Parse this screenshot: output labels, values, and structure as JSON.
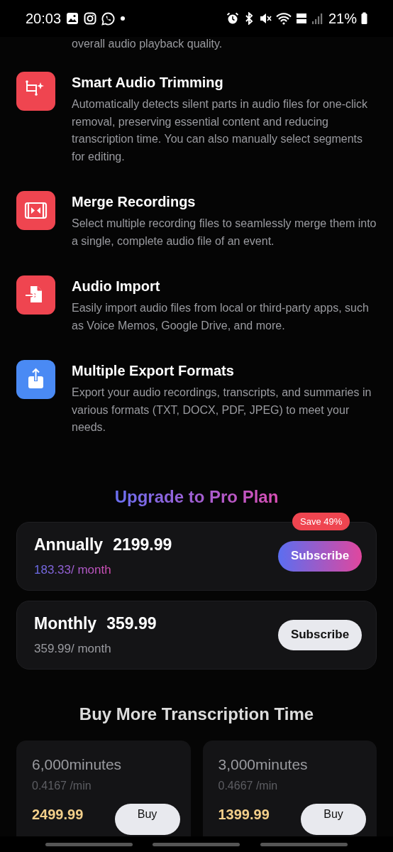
{
  "status_bar": {
    "time": "20:03",
    "battery": "21%"
  },
  "cut_text": "overall audio playback quality.",
  "features": [
    {
      "kind": "trim",
      "color": "#ef4550",
      "title": "Smart Audio Trimming",
      "description": "Automatically detects silent parts in audio files for one-click removal, preserving essential content and reducing transcription time. You can also manually select segments for editing."
    },
    {
      "kind": "merge",
      "color": "#ef4550",
      "title": "Merge Recordings",
      "description": "Select multiple recording files to seamlessly merge them into a single, complete audio file of an event."
    },
    {
      "kind": "import",
      "color": "#ef4550",
      "title": "Audio Import",
      "description": "Easily import audio files from local or third-party apps, such as Voice Memos, Google Drive, and more."
    },
    {
      "kind": "export",
      "color": "#4a8af4",
      "title": "Multiple Export Formats",
      "description": "Export your audio recordings, transcripts, and summaries in various formats (TXT, DOCX, PDF, JPEG) to meet your needs."
    }
  ],
  "upgrade": {
    "title": "Upgrade to Pro Plan",
    "plans": [
      {
        "name": "Annually",
        "price": "2199.99",
        "per_month": "183.33/ month",
        "badge": "Save 49%",
        "button": "Subscribe",
        "featured": true
      },
      {
        "name": "Monthly",
        "price": "359.99",
        "per_month": "359.99/ month",
        "button": "Subscribe",
        "featured": false
      }
    ]
  },
  "buy_more": {
    "title": "Buy More Transcription Time",
    "packs": [
      {
        "minutes": "6,000minutes",
        "rate": "0.4167 /min",
        "price": "2499.99",
        "button": "Buy"
      },
      {
        "minutes": "3,000minutes",
        "rate": "0.4667 /min",
        "price": "1399.99",
        "button": "Buy"
      }
    ]
  }
}
